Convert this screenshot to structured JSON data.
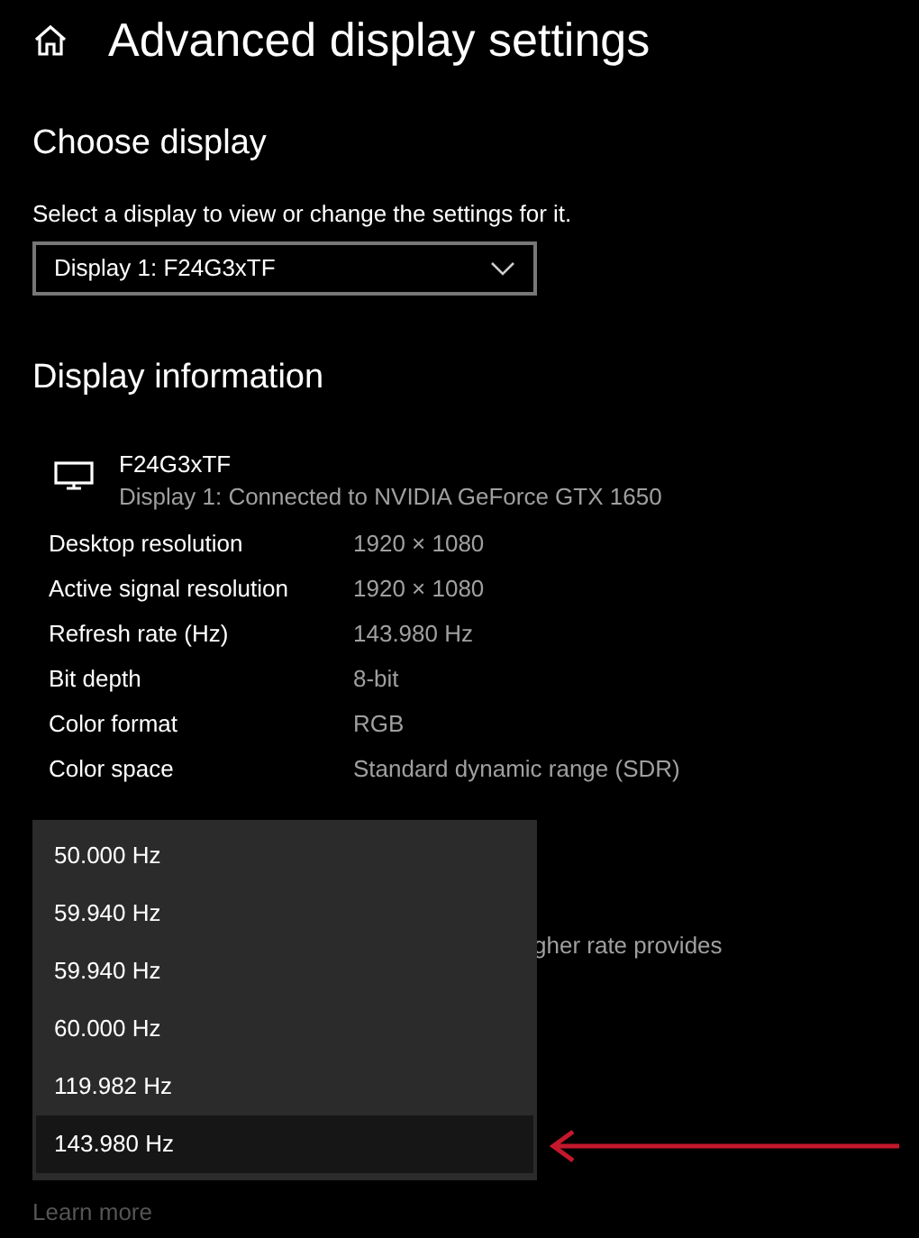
{
  "page": {
    "title": "Advanced display settings"
  },
  "choose_display": {
    "heading": "Choose display",
    "description": "Select a display to view or change the settings for it.",
    "selected_display": "Display 1: F24G3xTF"
  },
  "display_information": {
    "heading": "Display information",
    "monitor_name": "F24G3xTF",
    "monitor_connection": "Display 1: Connected to NVIDIA GeForce GTX 1650",
    "rows": [
      {
        "label": "Desktop resolution",
        "value": "1920 × 1080"
      },
      {
        "label": "Active signal resolution",
        "value": "1920 × 1080"
      },
      {
        "label": "Refresh rate (Hz)",
        "value": "143.980 Hz"
      },
      {
        "label": "Bit depth",
        "value": "8-bit"
      },
      {
        "label": "Color format",
        "value": "RGB"
      },
      {
        "label": "Color space",
        "value": "Standard dynamic range (SDR)"
      }
    ]
  },
  "partially_hidden_text": "gher rate provides",
  "refresh_rate_menu": [
    {
      "label": "50.000 Hz",
      "selected": false
    },
    {
      "label": "59.940 Hz",
      "selected": false
    },
    {
      "label": "59.940 Hz",
      "selected": false
    },
    {
      "label": "60.000 Hz",
      "selected": false
    },
    {
      "label": "119.982 Hz",
      "selected": false
    },
    {
      "label": "143.980 Hz",
      "selected": true
    }
  ],
  "learn_more": "Learn more"
}
